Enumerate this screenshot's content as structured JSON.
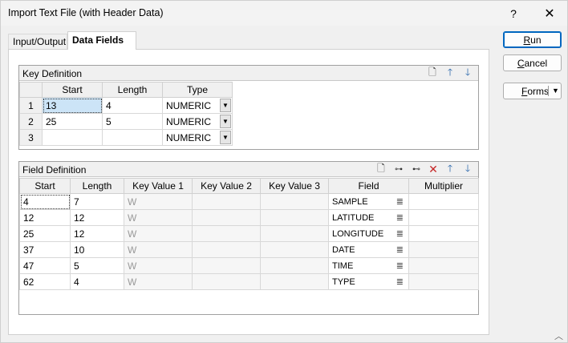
{
  "window": {
    "title": "Import Text File (with Header Data)",
    "help_glyph": "?",
    "close_glyph": "✕"
  },
  "tabs": [
    {
      "label": "Input/Output",
      "active": false
    },
    {
      "label": "Data Fields",
      "active": true
    }
  ],
  "key_definition": {
    "title": "Key Definition",
    "columns": [
      "Start",
      "Length",
      "Type"
    ],
    "rows": [
      {
        "num": "1",
        "start": "13",
        "length": "4",
        "type": "NUMERIC"
      },
      {
        "num": "2",
        "start": "25",
        "length": "5",
        "type": "NUMERIC"
      },
      {
        "num": "3",
        "start": "",
        "length": "",
        "type": "NUMERIC"
      }
    ],
    "toolbar_icons": [
      "new-document-icon",
      "arrow-up-icon",
      "arrow-down-icon"
    ]
  },
  "field_definition": {
    "title": "Field Definition",
    "columns": [
      "Start",
      "Length",
      "Key Value 1",
      "Key Value 2",
      "Key Value 3",
      "Field",
      "Multiplier"
    ],
    "rows": [
      {
        "start": "4",
        "length": "7",
        "kv1": "W",
        "kv2": "",
        "kv3": "",
        "field": "SAMPLE",
        "multiplier": ""
      },
      {
        "start": "12",
        "length": "12",
        "kv1": "W",
        "kv2": "",
        "kv3": "",
        "field": "LATITUDE",
        "multiplier": ""
      },
      {
        "start": "25",
        "length": "12",
        "kv1": "W",
        "kv2": "",
        "kv3": "",
        "field": "LONGITUDE",
        "multiplier": ""
      },
      {
        "start": "37",
        "length": "10",
        "kv1": "W",
        "kv2": "",
        "kv3": "",
        "field": "DATE",
        "multiplier": ""
      },
      {
        "start": "47",
        "length": "5",
        "kv1": "W",
        "kv2": "",
        "kv3": "",
        "field": "TIME",
        "multiplier": ""
      },
      {
        "start": "62",
        "length": "4",
        "kv1": "W",
        "kv2": "",
        "kv3": "",
        "field": "TYPE",
        "multiplier": ""
      }
    ],
    "toolbar_icons": [
      "new-document-icon",
      "insert-row-icon",
      "add-row-icon",
      "delete-icon",
      "arrow-up-icon",
      "arrow-down-icon"
    ]
  },
  "buttons": {
    "run": {
      "first": "R",
      "rest": "un"
    },
    "cancel": {
      "first": "C",
      "rest": "ancel"
    },
    "forms": {
      "first": "F",
      "rest": "orms"
    }
  },
  "colors": {
    "selection": "#cce4f7",
    "accent": "#0067c0",
    "delete": "#c62828"
  }
}
